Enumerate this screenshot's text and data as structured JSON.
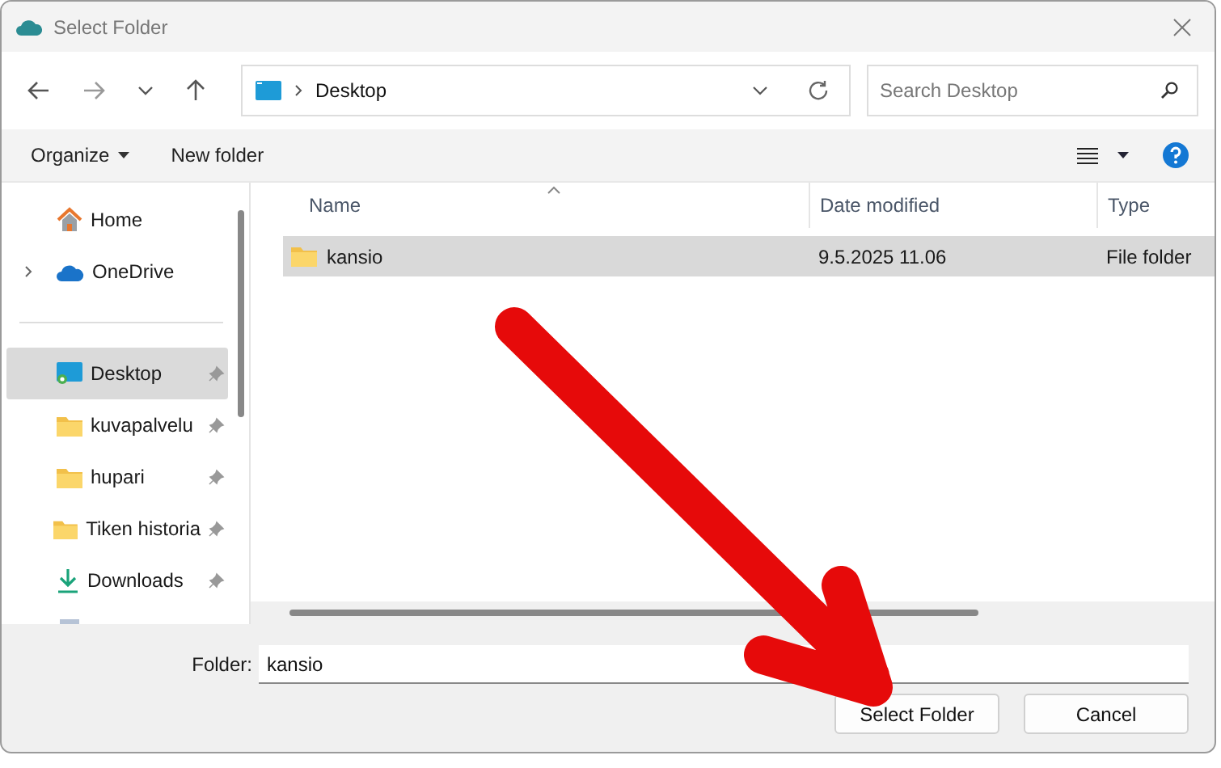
{
  "window": {
    "title": "Select Folder"
  },
  "address_bar": {
    "path": "Desktop"
  },
  "search": {
    "placeholder": "Search Desktop"
  },
  "toolbar": {
    "organize": "Organize",
    "new_folder": "New folder"
  },
  "sidebar": {
    "items": [
      {
        "label": "Home",
        "kind": "home",
        "pinned": false,
        "selected": false,
        "expandable": false
      },
      {
        "label": "OneDrive",
        "kind": "cloud",
        "pinned": false,
        "selected": false,
        "expandable": true
      },
      {
        "kind": "divider"
      },
      {
        "label": "Desktop",
        "kind": "desktop",
        "pinned": true,
        "selected": true,
        "expandable": false
      },
      {
        "label": "kuvapalvelu",
        "kind": "folder",
        "pinned": true,
        "selected": false,
        "expandable": false
      },
      {
        "label": "hupari",
        "kind": "folder",
        "pinned": true,
        "selected": false,
        "expandable": false
      },
      {
        "label": "Tiken historia",
        "kind": "folder",
        "pinned": true,
        "selected": false,
        "expandable": false
      },
      {
        "label": "Downloads",
        "kind": "download",
        "pinned": true,
        "selected": false,
        "expandable": false
      }
    ]
  },
  "table": {
    "columns": [
      "Name",
      "Date modified",
      "Type"
    ],
    "rows": [
      {
        "name": "kansio",
        "date": "9.5.2025 11.06",
        "type": "File folder",
        "selected": true
      }
    ]
  },
  "folder_field": {
    "label": "Folder:",
    "value": "kansio"
  },
  "buttons": [
    "Select Folder",
    "Cancel"
  ]
}
